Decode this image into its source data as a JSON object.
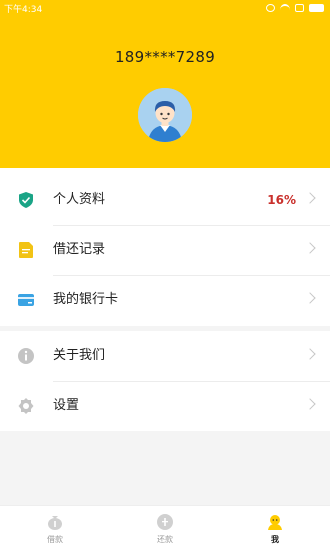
{
  "status_bar": {
    "time": "下午4:34"
  },
  "profile": {
    "phone": "189****7289"
  },
  "menu_primary": [
    {
      "label": "个人资料",
      "value": "16%",
      "icon": "shield-check-icon",
      "color": "#1aa486"
    },
    {
      "label": "借还记录",
      "value": "",
      "icon": "document-icon",
      "color": "#f2c315"
    },
    {
      "label": "我的银行卡",
      "value": "",
      "icon": "bank-card-icon",
      "color": "#3aa3e3"
    }
  ],
  "menu_secondary": [
    {
      "label": "关于我们",
      "icon": "info-icon",
      "color": "#c4c4c4"
    },
    {
      "label": "设置",
      "icon": "gear-icon",
      "color": "#c4c4c4"
    }
  ],
  "tabs": [
    {
      "label": "借款",
      "icon": "borrow-icon",
      "active": false
    },
    {
      "label": "还款",
      "icon": "repay-icon",
      "active": false
    },
    {
      "label": "我",
      "icon": "profile-icon",
      "active": true
    }
  ],
  "colors": {
    "header": "#ffcc00",
    "percent": "#c9302c",
    "avatar_bg": "#a9d2f0"
  }
}
